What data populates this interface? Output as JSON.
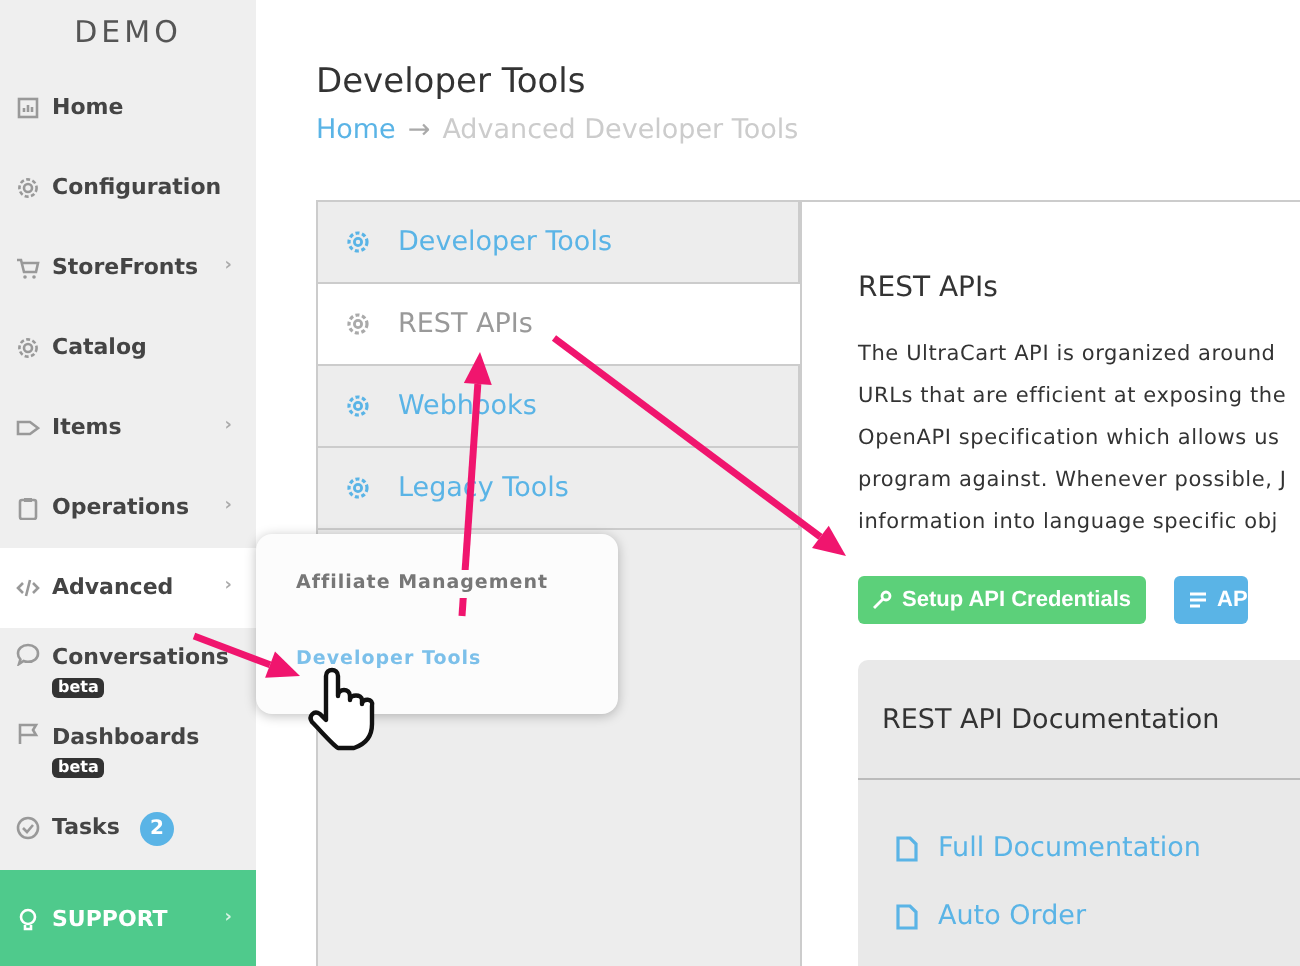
{
  "sidebar": {
    "logo": "DEMO",
    "items": [
      {
        "label": "Home",
        "selected": false
      },
      {
        "label": "Configuration",
        "selected": false
      },
      {
        "label": "StoreFronts",
        "chevron": "›",
        "selected": false
      },
      {
        "label": "Catalog",
        "selected": false
      },
      {
        "label": "Items",
        "chevron": "›",
        "selected": false
      },
      {
        "label": "Operations",
        "chevron": "›",
        "selected": false
      },
      {
        "label": "Advanced",
        "chevron": "›",
        "selected": true
      },
      {
        "label": "Conversations",
        "selected": false,
        "tag": "beta"
      },
      {
        "label": "Dashboards",
        "selected": false,
        "tag": "beta"
      },
      {
        "label": "Tasks",
        "selected": false,
        "count": "2"
      }
    ],
    "support": {
      "label": "SUPPORT",
      "chevron": "›"
    }
  },
  "flyout": {
    "items": [
      {
        "label": "Affiliate Management",
        "selected": false
      },
      {
        "label": "Developer Tools",
        "selected": true
      }
    ]
  },
  "page": {
    "title": "Developer Tools",
    "breadcrumb": {
      "home": "Home",
      "separator": "→",
      "current": "Advanced Developer Tools"
    }
  },
  "tabs": [
    {
      "label": "Developer Tools",
      "selected": false
    },
    {
      "label": "REST APIs",
      "selected": true
    },
    {
      "label": "Webhooks",
      "selected": false
    },
    {
      "label": "Legacy Tools",
      "selected": false
    }
  ],
  "content": {
    "heading": "REST APIs",
    "paragraph_lines": [
      "The UltraCart API is organized around",
      "URLs that are efficient at exposing the",
      "OpenAPI specification which allows us",
      "program against. Whenever possible, J",
      "information into language specific obj"
    ],
    "buttons": [
      {
        "kind": "success",
        "label": "Setup API Credentials"
      },
      {
        "kind": "info",
        "label": "AP"
      }
    ],
    "docs": {
      "title": "REST API Documentation",
      "links": [
        "Full Documentation",
        "Auto Order"
      ]
    }
  }
}
